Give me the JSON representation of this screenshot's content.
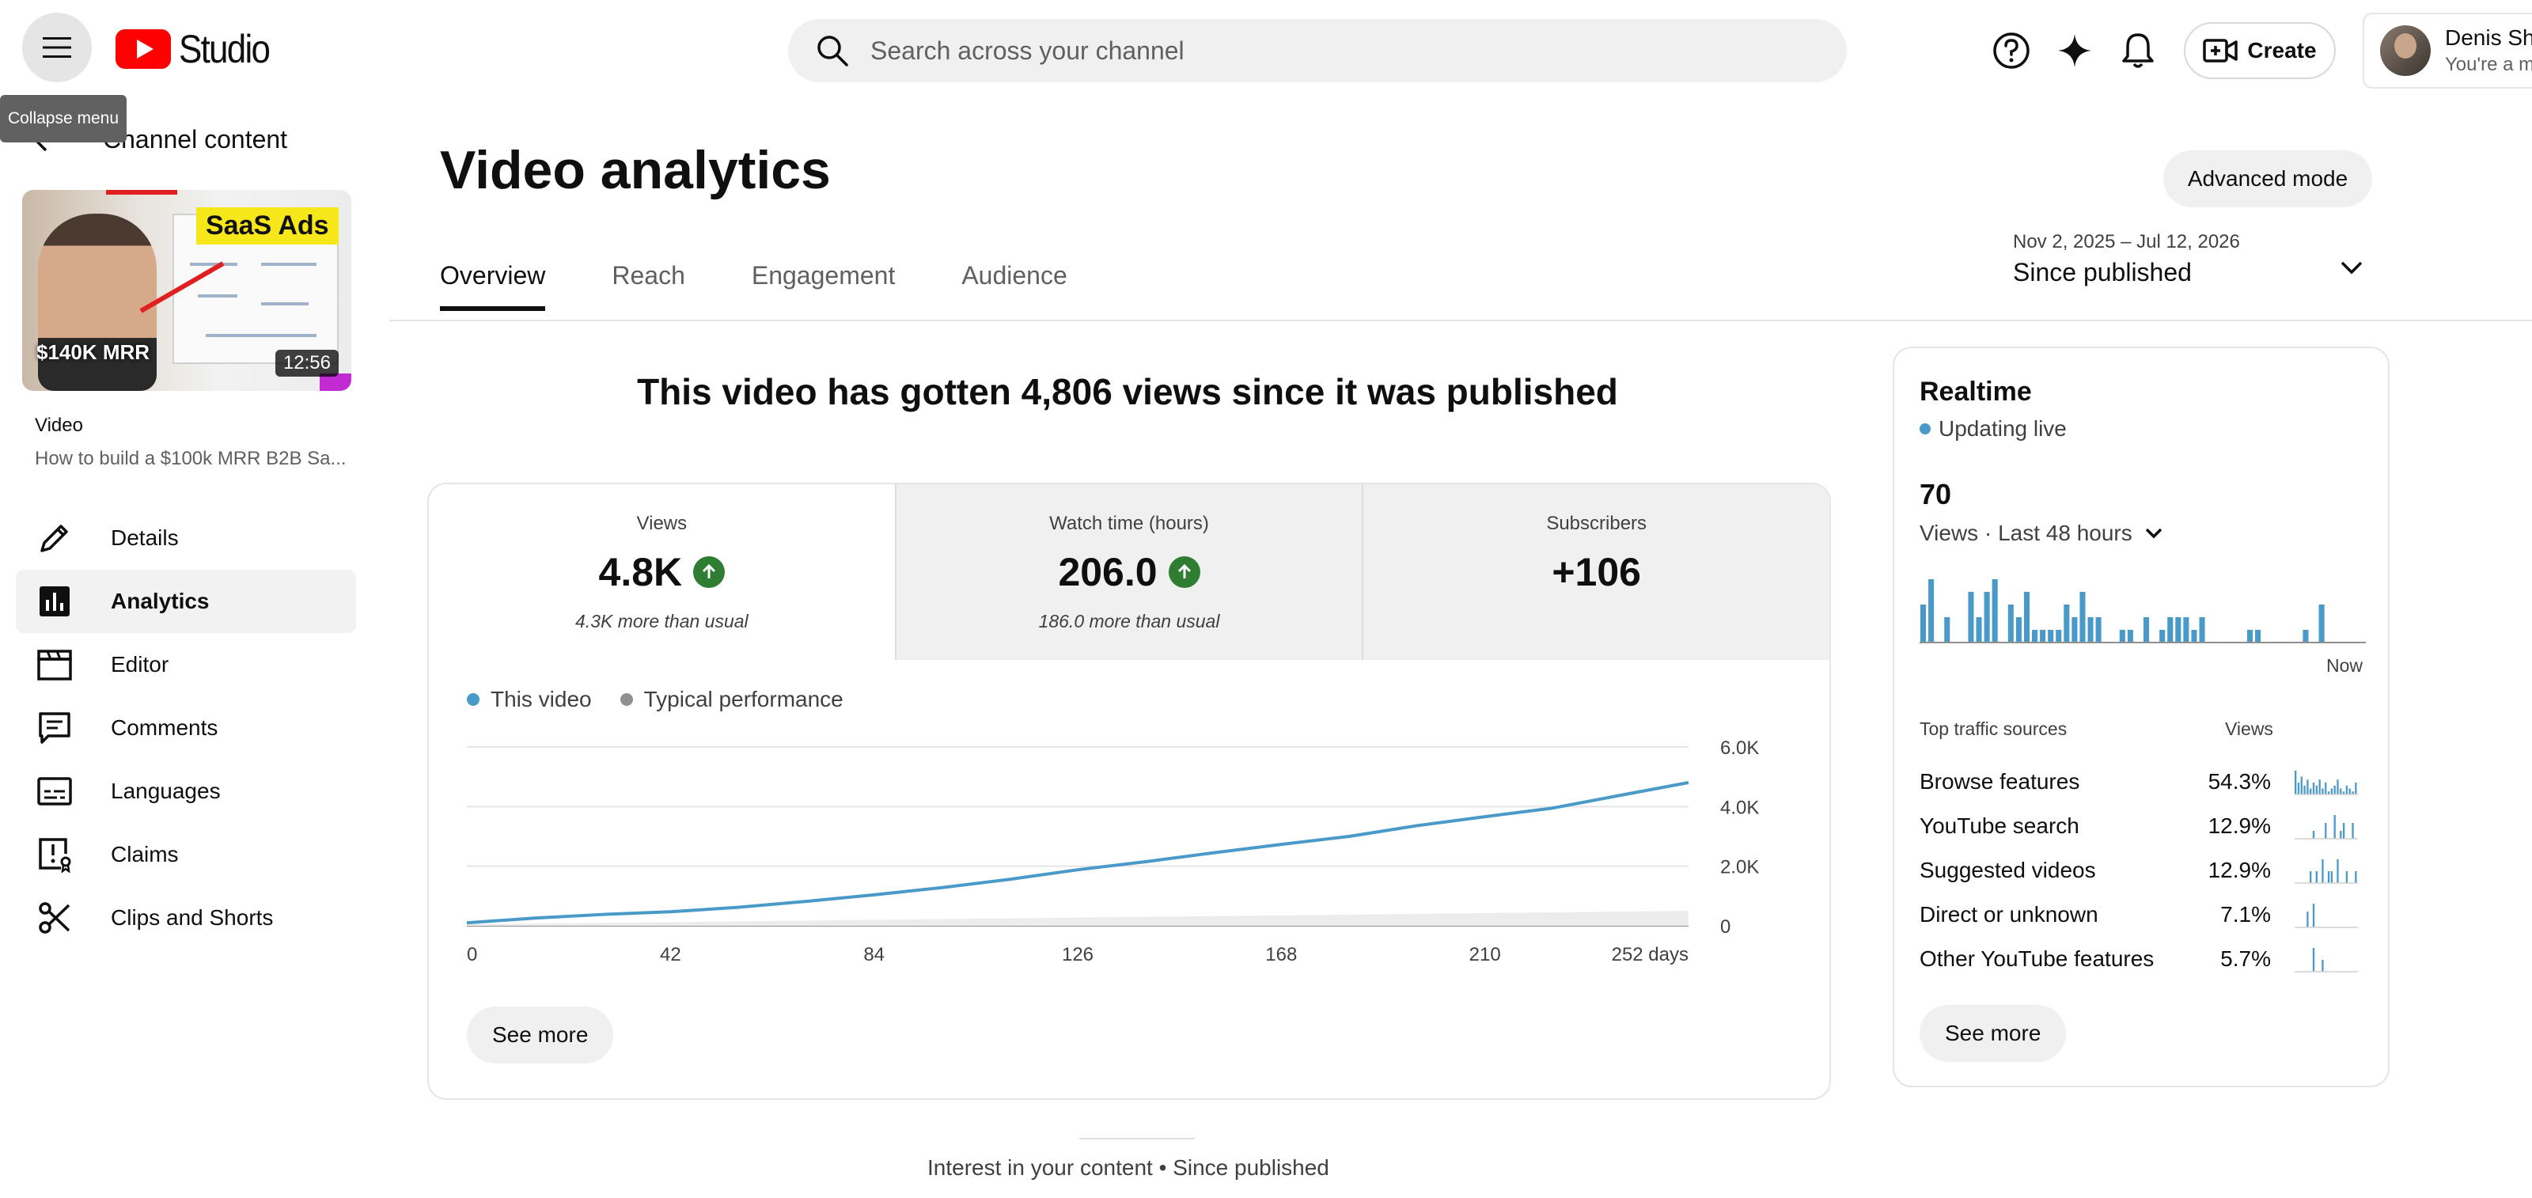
{
  "app": {
    "logo_text": "Studio"
  },
  "search": {
    "placeholder": "Search across your channel"
  },
  "header": {
    "create_label": "Create",
    "tooltip": "Collapse menu"
  },
  "account": {
    "name": "Denis Sha",
    "subtitle": "You're a ma"
  },
  "sidebar": {
    "back_label": "Channel content",
    "video_label": "Video",
    "video_title": "How to build a $100k MRR B2B Sa...",
    "thumbnail": {
      "badge": "SaaS Ads",
      "caption": "$140K MRR",
      "duration": "12:56"
    },
    "items": [
      {
        "label": "Details",
        "icon": "pencil-icon"
      },
      {
        "label": "Analytics",
        "icon": "analytics-icon",
        "active": true
      },
      {
        "label": "Editor",
        "icon": "clapperboard-icon"
      },
      {
        "label": "Comments",
        "icon": "comment-icon"
      },
      {
        "label": "Languages",
        "icon": "subtitles-icon"
      },
      {
        "label": "Claims",
        "icon": "claims-icon"
      },
      {
        "label": "Clips and Shorts",
        "icon": "scissors-icon"
      }
    ]
  },
  "main": {
    "title": "Video analytics",
    "advanced_mode": "Advanced mode",
    "tabs": [
      "Overview",
      "Reach",
      "Engagement",
      "Audience"
    ],
    "date_range": "Nov 2, 2025 – Jul 12, 2026",
    "date_label": "Since published",
    "headline": "This video has gotten 4,806 views since it was published",
    "metrics": [
      {
        "label": "Views",
        "value": "4.8K",
        "note": "4.3K more than usual",
        "up": true
      },
      {
        "label": "Watch time (hours)",
        "value": "206.0",
        "note": "186.0 more than usual",
        "up": true
      },
      {
        "label": "Subscribers",
        "value": "+106",
        "note": "",
        "up": false
      }
    ],
    "see_more": "See more",
    "footer": "Interest in your content • Since published"
  },
  "chart_data": {
    "type": "line",
    "series": [
      {
        "name": "This video",
        "color": "#4a9ac9",
        "x": [
          0,
          14,
          28,
          42,
          56,
          70,
          84,
          98,
          112,
          126,
          140,
          154,
          168,
          182,
          196,
          210,
          224,
          238,
          252
        ],
        "y": [
          100,
          260,
          380,
          470,
          620,
          820,
          1040,
          1280,
          1560,
          1880,
          2150,
          2450,
          2730,
          3000,
          3360,
          3660,
          3950,
          4380,
          4806
        ]
      },
      {
        "name": "Typical performance",
        "color": "#909090",
        "x": [
          0,
          252
        ],
        "y": [
          50,
          500
        ]
      }
    ],
    "x_ticks": [
      "0",
      "42",
      "84",
      "126",
      "168",
      "210",
      "252 days"
    ],
    "x_tick_values": [
      0,
      42,
      84,
      126,
      168,
      210,
      252
    ],
    "y_ticks": [
      "0",
      "2.0K",
      "4.0K",
      "6.0K"
    ],
    "y_tick_values": [
      0,
      2000,
      4000,
      6000
    ],
    "xlim": [
      0,
      252
    ],
    "ylim": [
      0,
      6000
    ],
    "grid": true,
    "legend": "top-left"
  },
  "realtime": {
    "title": "Realtime",
    "status": "Updating live",
    "count": "70",
    "period": "Views · Last 48 hours",
    "now_label": "Now",
    "bars": [
      3,
      5,
      0,
      2,
      0,
      0,
      4,
      2,
      4,
      5,
      0,
      3,
      2,
      4,
      1,
      1,
      1,
      1,
      3,
      2,
      4,
      2,
      2,
      0,
      0,
      1,
      1,
      0,
      2,
      0,
      1,
      2,
      2,
      2,
      1,
      2,
      0,
      0,
      0,
      0,
      0,
      1,
      1,
      0,
      0,
      0,
      0,
      0,
      1,
      0,
      3,
      0,
      0,
      0,
      0,
      0
    ],
    "bars_max": 5,
    "sources_header": "Top traffic sources",
    "views_header": "Views",
    "sources": [
      {
        "name": "Browse features",
        "pct": "54.3%",
        "spark": [
          8,
          4,
          6,
          3,
          5,
          2,
          4,
          3,
          5,
          2,
          4,
          1,
          2,
          3,
          5,
          2,
          1,
          3,
          2,
          1,
          4
        ]
      },
      {
        "name": "YouTube search",
        "pct": "12.9%",
        "spark": [
          0,
          0,
          0,
          0,
          0,
          0,
          1,
          0,
          0,
          0,
          2,
          0,
          0,
          3,
          0,
          1,
          2,
          0,
          0,
          2,
          0
        ]
      },
      {
        "name": "Suggested videos",
        "pct": "12.9%",
        "spark": [
          0,
          0,
          0,
          0,
          0,
          1,
          0,
          1,
          0,
          2,
          0,
          1,
          1,
          0,
          2,
          0,
          0,
          1,
          0,
          0,
          1
        ]
      },
      {
        "name": "Direct or unknown",
        "pct": "7.1%",
        "spark": [
          0,
          0,
          0,
          0,
          2,
          0,
          3,
          0,
          0,
          0,
          0,
          0,
          0,
          0,
          0,
          0,
          0,
          0,
          0,
          0,
          0
        ]
      },
      {
        "name": "Other YouTube features",
        "pct": "5.7%",
        "spark": [
          0,
          0,
          0,
          0,
          0,
          0,
          2,
          0,
          0,
          1,
          0,
          0,
          0,
          0,
          0,
          0,
          0,
          0,
          0,
          0,
          0
        ]
      }
    ],
    "see_more": "See more",
    "accent": "#4a9ac9"
  }
}
